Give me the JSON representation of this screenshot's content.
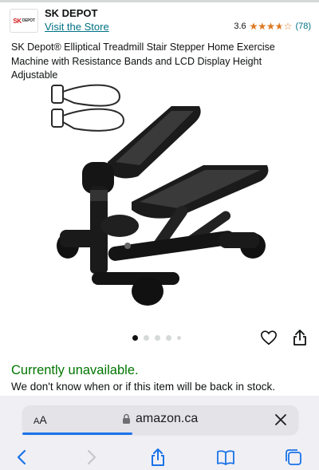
{
  "brand": {
    "logo_text": "SK",
    "logo_small_text": "DEPOT",
    "name": "SK DEPOT",
    "store_link": "Visit the Store"
  },
  "rating": {
    "value": "3.6",
    "stars_fraction": 0.72,
    "stars_glyphs": "★★★★★",
    "count": "(78)"
  },
  "product": {
    "title": "SK Depot® Elliptical Treadmill Stair Stepper Home Exercise Machine with Resistance Bands and LCD Display Height Adjustable",
    "image_count": 5,
    "active_image": 0
  },
  "availability": {
    "status": "Currently unavailable.",
    "message": "We don't know when or if this item will be back in stock."
  },
  "browser": {
    "aa_label_big": "A",
    "aa_label_small": "A",
    "url": "amazon.ca",
    "load_progress": 0.4
  },
  "colors": {
    "link": "#007185",
    "star": "#de7921",
    "unavailable": "#007600",
    "ios_blue": "#1a73e8"
  },
  "icons": [
    "heart-icon",
    "share-icon",
    "lock-icon",
    "close-icon",
    "back-icon",
    "forward-icon",
    "safari-share-icon",
    "bookmarks-icon",
    "tabs-icon"
  ]
}
